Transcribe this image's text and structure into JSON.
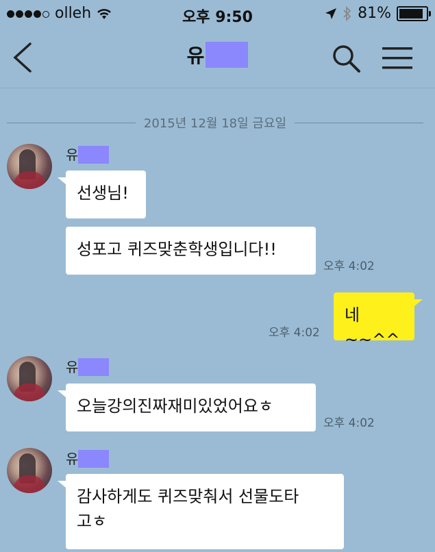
{
  "status_bar": {
    "carrier": "olleh",
    "time": "오후 9:50",
    "battery": "81%",
    "battery_level": 0.81
  },
  "nav": {
    "title_visible": "유"
  },
  "date_divider": "2015년 12월 18일 금요일",
  "messages": [
    {
      "sender": "유",
      "text": "선생님!"
    },
    {
      "text": "성포고 퀴즈맞춘학생입니다!!",
      "time": "오후 4:02"
    },
    {
      "mine": true,
      "text": "네~~^^",
      "time": "오후 4:02"
    },
    {
      "sender": "유",
      "text": "오늘강의진짜재미있었어요ㅎ",
      "time": "오후 4:02"
    },
    {
      "sender": "유",
      "text_line1": "감사하게도 퀴즈맞춰서 선물도타",
      "text_line2": "고ㅎ"
    }
  ],
  "colors": {
    "background": "#9bbbd4",
    "my_bubble": "#fef01b",
    "their_bubble": "#ffffff",
    "name_mask": "#8b87fd"
  }
}
